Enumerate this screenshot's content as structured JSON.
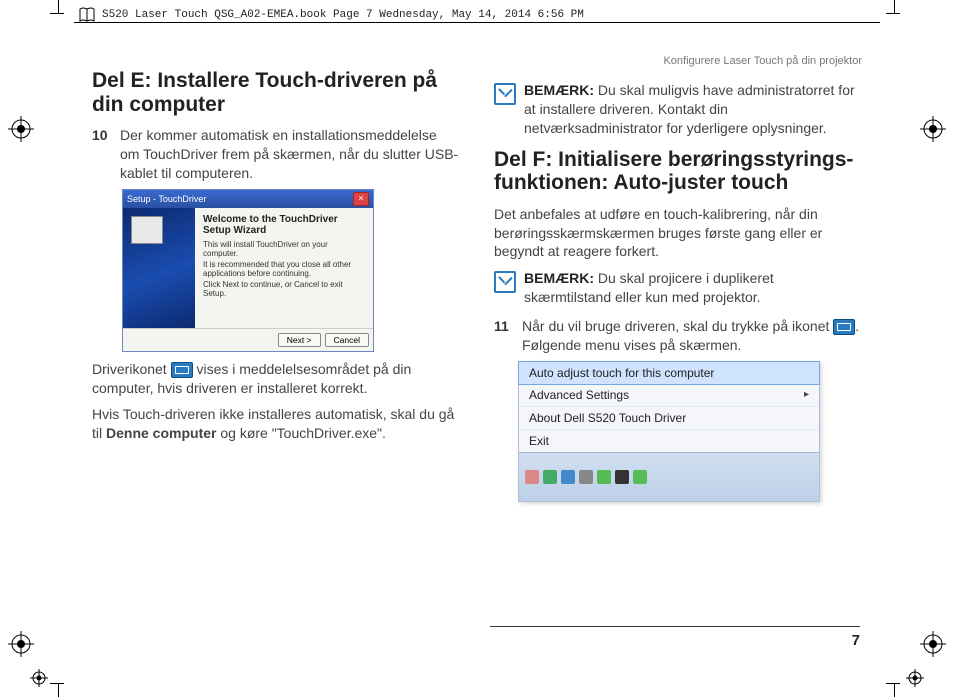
{
  "header": {
    "text": "S520 Laser Touch QSG_A02-EMEA.book  Page 7  Wednesday, May 14, 2014  6:56 PM"
  },
  "running_head": "Konfigurere Laser Touch på din projektor",
  "left": {
    "heading": "Del E: Installere Touch-driveren på din computer",
    "step10_num": "10",
    "step10_text": "Der kommer automatisk en installationsmeddelelse om TouchDriver frem på skærmen, når du slutter USB-kablet til computeren.",
    "wizard": {
      "title": "Setup - TouchDriver",
      "h": "Welcome to the TouchDriver Setup Wizard",
      "t1": "This will install TouchDriver on your computer.",
      "t2": "It is recommended that you close all other applications before continuing.",
      "t3": "Click Next to continue, or Cancel to exit Setup.",
      "next": "Next >",
      "cancel": "Cancel"
    },
    "after1_a": "Driverikonet ",
    "after1_b": " vises i meddelelsesområdet på din computer, hvis driveren er installeret korrekt.",
    "after2_a": "Hvis Touch-driveren ikke installeres automatisk, skal du gå til ",
    "after2_bold": "Denne computer",
    "after2_b": " og køre \"TouchDriver.exe\"."
  },
  "right": {
    "note1_label": "BEMÆRK:",
    "note1_text": " Du skal muligvis have administratorret for at installere driveren. Kontakt din netværksadministrator for yderligere oplysninger.",
    "heading": "Del F: Initialisere berøringsstyrings-funktionen: Auto-juster touch",
    "intro": "Det anbefales at udføre en touch-kalibrering, når din berøringsskærmskærmen bruges første gang eller er begyndt at reagere forkert.",
    "note2_label": "BEMÆRK:",
    "note2_text": " Du skal projicere i duplikeret skærmtilstand eller kun med projektor.",
    "step11_num": "11",
    "step11_a": "Når du vil bruge driveren, skal du trykke på ikonet ",
    "step11_b": ". Følgende menu vises på skærmen.",
    "menu": {
      "i1": "Auto adjust touch for this computer",
      "i2": "Advanced Settings",
      "i3": "About Dell S520 Touch Driver",
      "i4": "Exit"
    }
  },
  "page_number": "7"
}
